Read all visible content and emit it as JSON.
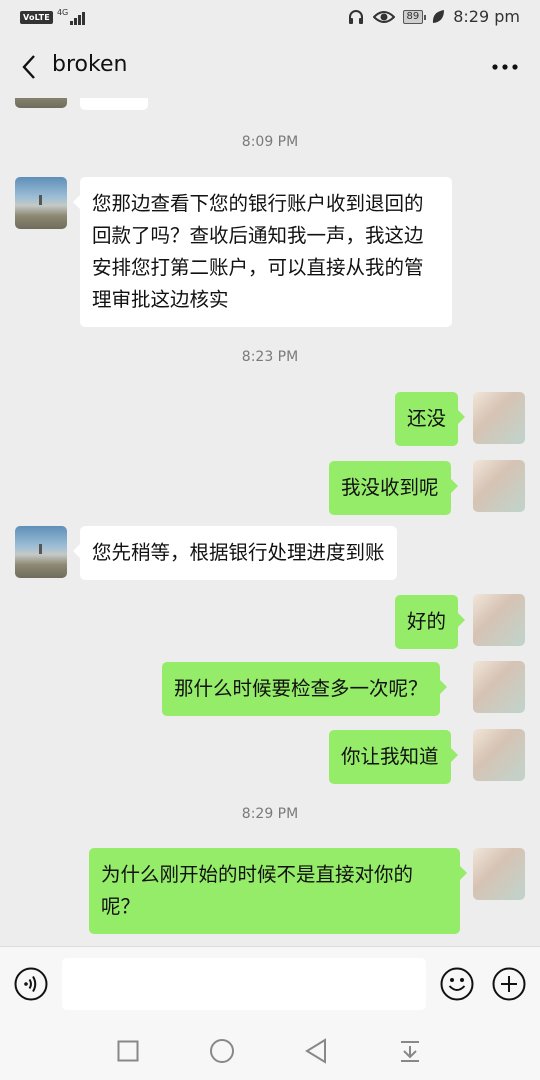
{
  "status_bar": {
    "volte": "VoLTE",
    "network": "4G",
    "battery": "89",
    "time": "8:29 pm"
  },
  "header": {
    "title": "broken"
  },
  "chat": {
    "timestamps": [
      "8:09 PM",
      "8:23 PM",
      "8:29 PM"
    ],
    "messages": [
      {
        "from": "other",
        "text": "您那边查看下您的银行账户收到退回的回款了吗？查收后通知我一声，我这边安排您打第二账户，可以直接从我的管理审批这边核实"
      },
      {
        "from": "me",
        "text": "还没"
      },
      {
        "from": "me",
        "text": "我没收到呢"
      },
      {
        "from": "other",
        "text": "您先稍等，根据银行处理进度到账"
      },
      {
        "from": "me",
        "text": "好的"
      },
      {
        "from": "me",
        "text": "那什么时候要检查多一次呢？"
      },
      {
        "from": "me",
        "text": "你让我知道"
      },
      {
        "from": "me",
        "text": "为什么刚开始的时候不是直接对你的呢？"
      }
    ]
  },
  "input_bar": {
    "value": "",
    "icons": [
      "voice-icon",
      "emoji-icon",
      "plus-icon"
    ]
  },
  "nav_bar": {
    "icons": [
      "recent-apps-icon",
      "home-icon",
      "back-icon",
      "notification-pulldown-icon"
    ]
  },
  "colors": {
    "background": "#ededed",
    "incoming_bubble": "#ffffff",
    "outgoing_bubble": "#95ec69",
    "timestamp": "#7a7a7a"
  }
}
